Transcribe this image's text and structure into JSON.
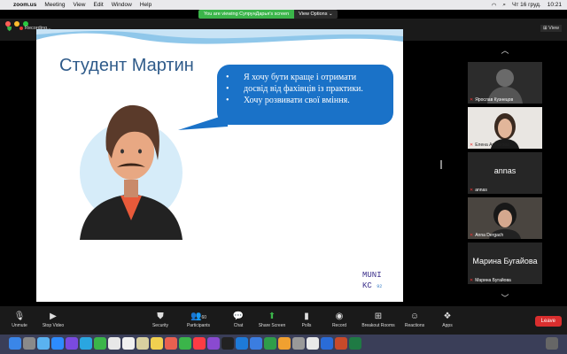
{
  "menubar": {
    "items": [
      "zoom.us",
      "Meeting",
      "View",
      "Edit",
      "Window",
      "Help"
    ],
    "datetime": "Чт 16 груд.",
    "time": "10:21"
  },
  "banner": {
    "viewing_text": "You are viewing СупрунДарья's screen",
    "options_label": "View Options ⌄"
  },
  "meeting": {
    "recording_label": "Recording...",
    "view_label": "View"
  },
  "slide": {
    "title": "Студент Мартин",
    "bullets": [
      "Я хочу бути краще і отримати",
      "досвід від фахівців із практики.",
      "Хочу розвивати свої вміння."
    ],
    "logo_line1": "MUNI",
    "logo_line2": "KC",
    "logo_sub": "92"
  },
  "gallery": {
    "participants": [
      {
        "name": "Ярослав Кузнецов",
        "display": ""
      },
      {
        "name": "Елена Артюхова",
        "display": ""
      },
      {
        "name": "annas",
        "display": "annas"
      },
      {
        "name": "Anna Dergach",
        "display": ""
      },
      {
        "name": "Марина Бугайова",
        "display": "Марина Бугайова"
      }
    ]
  },
  "toolbar": {
    "unmute": "Unmute",
    "stop_video": "Stop Video",
    "security": "Security",
    "participants": "Participants",
    "participants_count": "60",
    "chat": "Chat",
    "share_screen": "Share Screen",
    "polls": "Polls",
    "record": "Record",
    "breakout_rooms": "Breakout Rooms",
    "reactions": "Reactions",
    "apps": "Apps",
    "leave": "Leave"
  },
  "colors": {
    "accent_green": "#3bb54a",
    "bubble_blue": "#1a72c8",
    "leave_red": "#d92e2e",
    "title_blue": "#2f5b8a"
  }
}
